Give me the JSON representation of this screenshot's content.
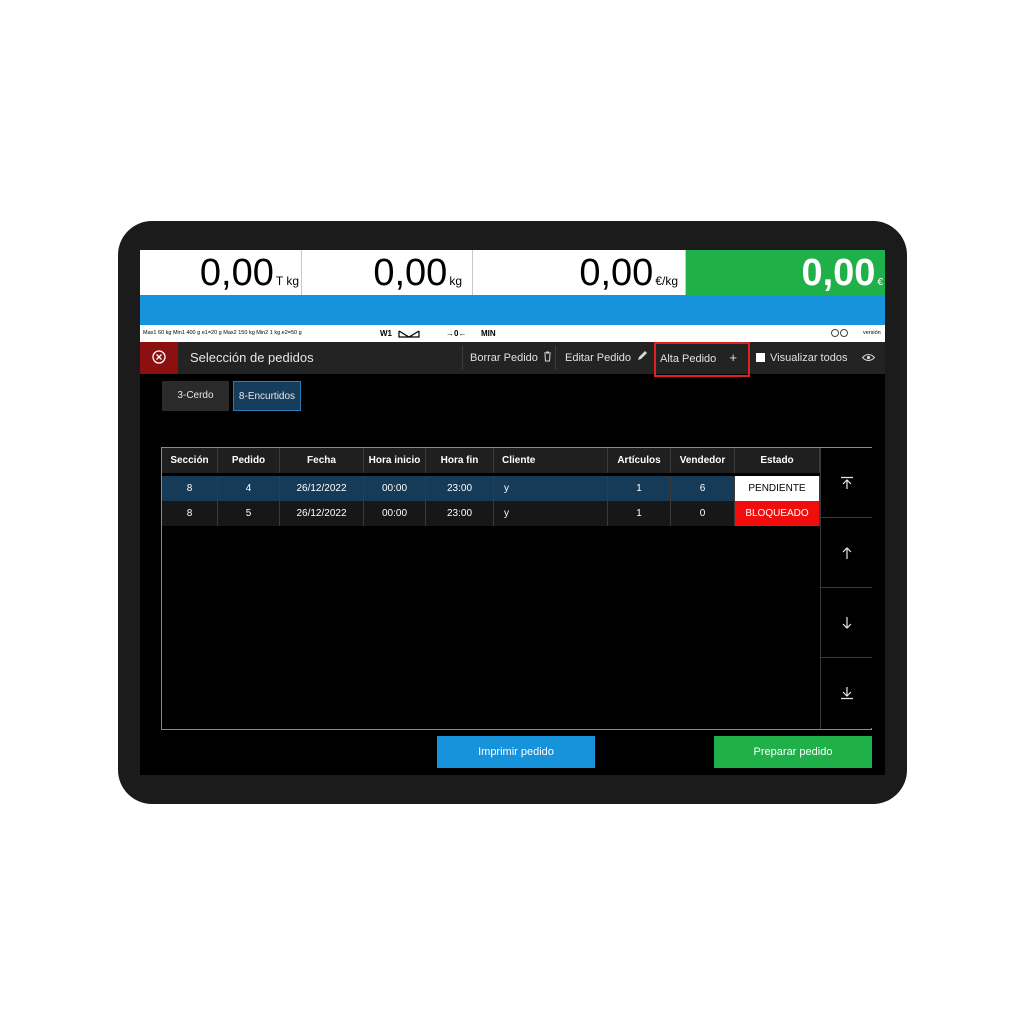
{
  "weights": {
    "tare": {
      "value": "0,00",
      "unit": "T kg"
    },
    "weight": {
      "value": "0,00",
      "unit": "kg"
    },
    "price": {
      "value": "0,00",
      "unit": "€/kg"
    },
    "total": {
      "value": "0,00",
      "unit": "€"
    }
  },
  "info_strip": {
    "limits": "Max1 60 kg Min1 400 g e1=20 g Max2 150 kg Min2 1 kg e2=50 g",
    "w1": "W1",
    "zero": "→0←",
    "min": "MIN",
    "version": "versión"
  },
  "toolbar": {
    "title": "Selección de pedidos",
    "borrar": "Borrar Pedido",
    "editar": "Editar Pedido",
    "alta": "Alta Pedido",
    "visualizar": "Visualizar todos"
  },
  "sections": [
    {
      "label": "3-Cerdo"
    },
    {
      "label": "8-Encurtidos"
    }
  ],
  "table": {
    "headers": [
      "Sección",
      "Pedido",
      "Fecha",
      "Hora inicio",
      "Hora fin",
      "Cliente",
      "Artículos",
      "Vendedor",
      "Estado"
    ],
    "rows": [
      [
        "8",
        "4",
        "26/12/2022",
        "00:00",
        "23:00",
        "y",
        "1",
        "6",
        "PENDIENTE"
      ],
      [
        "8",
        "5",
        "26/12/2022",
        "00:00",
        "23:00",
        "y",
        "1",
        "0",
        "BLOQUEADO"
      ]
    ]
  },
  "buttons": {
    "imprimir": "Imprimir pedido",
    "preparar": "Preparar pedido"
  },
  "icons": {
    "close": "close-circle-icon",
    "trash": "trash-icon",
    "pencil": "pencil-icon",
    "plus": "plus-icon",
    "eye": "eye-icon",
    "scroll_top": "scroll-top-icon",
    "scroll_up": "arrow-up-icon",
    "scroll_down": "arrow-down-icon",
    "scroll_bottom": "scroll-bottom-icon"
  },
  "colors": {
    "total_bg": "#1fb04a",
    "blue_band": "#1793dc",
    "close_bg": "#8c1010",
    "selected_row": "#163b58",
    "estado_bloqueado": "#f20d0d",
    "imprimir_bg": "#1793dc",
    "preparar_bg": "#1fb04a",
    "highlight_border": "#e12020"
  }
}
